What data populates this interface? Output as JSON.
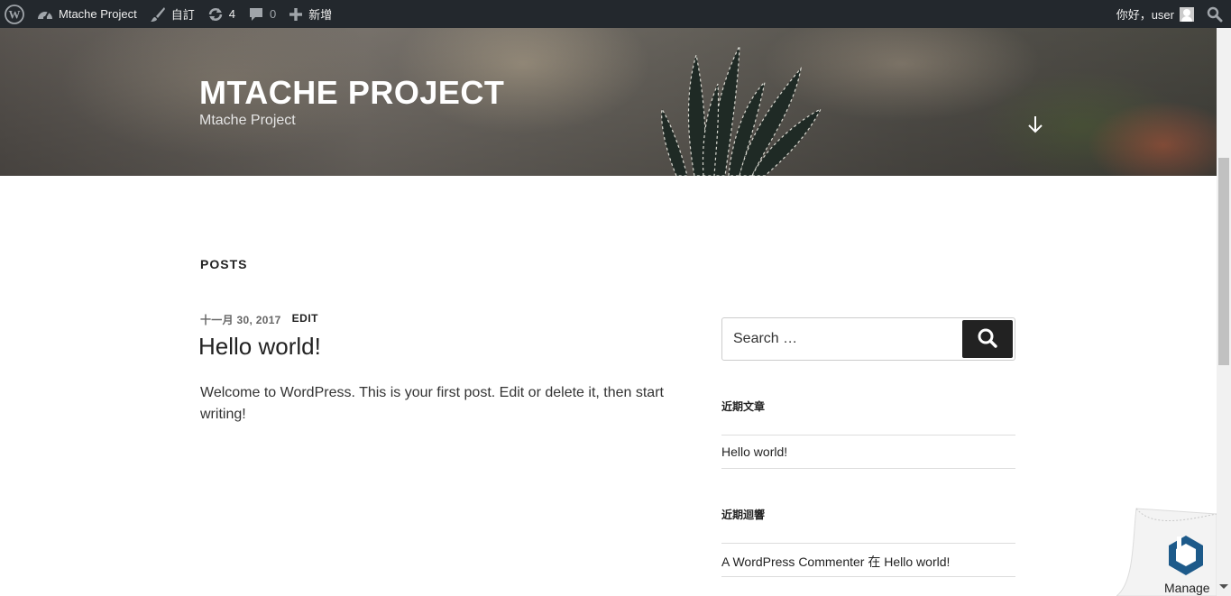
{
  "adminbar": {
    "site_name": "Mtache Project",
    "customize_label": "自訂",
    "updates_count": "4",
    "comments_count": "0",
    "new_label": "新增",
    "greeting": "你好，user"
  },
  "header": {
    "site_title": "MTACHE PROJECT",
    "site_description": "Mtache Project"
  },
  "main": {
    "page_heading": "POSTS",
    "post": {
      "date": "十一月 30, 2017",
      "edit_label": "EDIT",
      "title": "Hello world!",
      "excerpt": "Welcome to WordPress. This is your first post. Edit or delete it, then start writing!"
    }
  },
  "sidebar": {
    "search_placeholder": "Search …",
    "recent_posts_title": "近期文章",
    "recent_posts": [
      "Hello world!"
    ],
    "recent_comments_title": "近期迴響",
    "recent_comment": {
      "author": "A WordPress Commenter",
      "connector": "在",
      "post": "Hello world!"
    }
  },
  "manage_widget": {
    "label": "Manage"
  },
  "colors": {
    "adminbar_bg": "#23282d",
    "button_dark": "#222222"
  }
}
